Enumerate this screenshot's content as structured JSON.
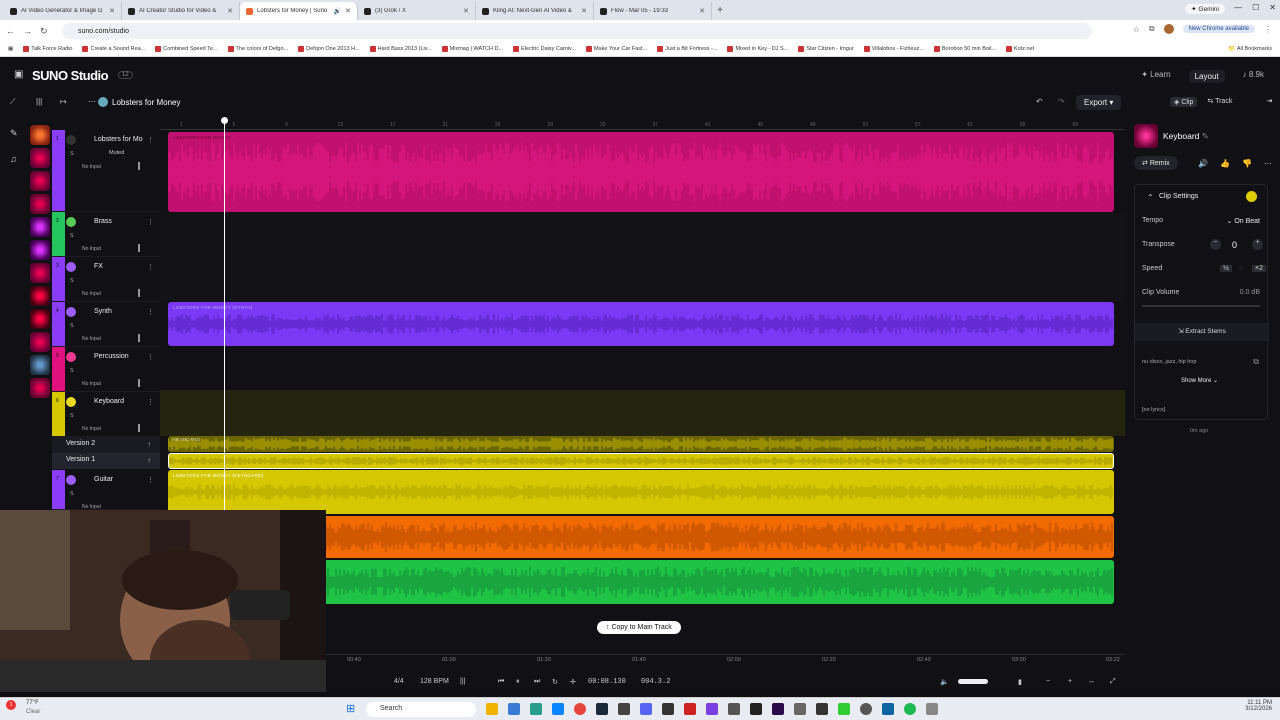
{
  "browser": {
    "tabs": [
      {
        "title": "AI Video Generator & Image G",
        "active": false
      },
      {
        "title": "AI Creator Studio for Video &",
        "active": false
      },
      {
        "title": "Lobsters for Money | Suno",
        "active": true
      },
      {
        "title": "(3) Grok / X",
        "active": false
      },
      {
        "title": "Kling AI: Next-Gen AI Video &",
        "active": false
      },
      {
        "title": "Flow - Mar 05 - 19:33",
        "active": false
      }
    ],
    "gemini_label": "Gemini",
    "url": "suno.com/studio",
    "new_chrome": "New Chrome available",
    "bookmarks": [
      "Talk Force Radio",
      "Create a Sound Rea...",
      "Combined Speed Te...",
      "The colors of Defgo...",
      "Defqon One 2013 H...",
      "Hard Bass 2013 (Liv...",
      "Mixmag | WATCH D...",
      "Electric Daisy Carniv...",
      "Make Your Car Fast...",
      "Just a Bit Fortress -...",
      "Mixed in Key - DJ S...",
      "Star Citizen - Imgur",
      "Villalobos - Fizheuz...",
      "Boroboo 50 min Boil...",
      "Kotz.net"
    ],
    "all_bookmarks": "All Bookmarks"
  },
  "app": {
    "logo": "SUNO Studio",
    "badge": "12",
    "learn": "Learn",
    "layout": "Layout",
    "credits": "8.9k",
    "song_title": "Lobsters for Money",
    "export": "Export",
    "clip_tab": "Clip",
    "track_tab": "Track"
  },
  "tracks": [
    {
      "num": "1",
      "name": "Lobsters for Mo",
      "color": "#e0117f",
      "status": "Muted",
      "input": "No Input"
    },
    {
      "num": "2",
      "name": "Brass",
      "color": "#22c55e",
      "input": "No Input"
    },
    {
      "num": "3",
      "name": "FX",
      "color": "#8b3cf7",
      "input": "No Input"
    },
    {
      "num": "4",
      "name": "Synth",
      "color": "#8b3cf7",
      "input": "No Input"
    },
    {
      "num": "5",
      "name": "Percussion",
      "color": "#e0117f",
      "input": "No Input"
    },
    {
      "num": "6",
      "name": "Keyboard",
      "color": "#d6c800",
      "input": "No Input"
    },
    {
      "num": "7",
      "name": "Guitar",
      "color": "#8b3cf7",
      "input": "No Input"
    }
  ],
  "versions": [
    "Version 2",
    "Version 1"
  ],
  "ruler_marks": [
    "1",
    "5",
    "9",
    "13",
    "17",
    "21",
    "25",
    "29",
    "33",
    "37",
    "41",
    "45",
    "49",
    "53",
    "57",
    "61",
    "65",
    "69"
  ],
  "clip_labels": {
    "main": "LOBSTERS FOR MONEY",
    "synth": "LOBSTERS FOR MONEY (SYNTH)",
    "keyboard": "KEYBOARD",
    "keyboard_v1": "LOBSTERS FOR MONEY (KEYBOARD)"
  },
  "copy_button": "Copy to Main Track",
  "mini_times": [
    "00:40",
    "01:00",
    "01:20",
    "01:40",
    "02:00",
    "02:20",
    "02:40",
    "03:00",
    "03:22"
  ],
  "transport": {
    "sig": "4/4",
    "bpm": "128 BPM",
    "time": "00:08.130",
    "bars": "004.3.2"
  },
  "panel": {
    "clip_name": "Keyboard",
    "remix": "Remix",
    "clip_settings": "Clip Settings",
    "tempo_label": "Tempo",
    "tempo_value": "On Beat",
    "transpose_label": "Transpose",
    "transpose_value": "0",
    "speed_label": "Speed",
    "speed_half": "½",
    "speed_double": "×2",
    "clip_volume_label": "Clip Volume",
    "clip_volume_value": "0.0 dB",
    "extract": "Extract Stems",
    "tags": "nu disco, jazz, hip hop",
    "show_more": "Show More",
    "lyrics": "[no lyrics]",
    "ago": "0m ago"
  },
  "taskbar": {
    "weather_temp": "77°F",
    "weather_desc": "Clear",
    "search": "Search",
    "time": "11:11 PM",
    "date": "3/12/2026"
  }
}
